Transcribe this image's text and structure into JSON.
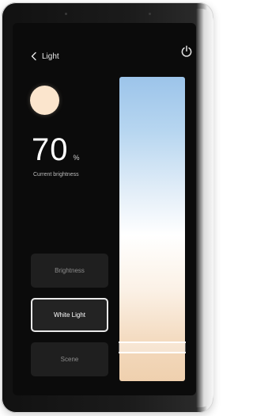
{
  "header": {
    "back_label": "Light"
  },
  "status": {
    "color_dot": "#fbe5cd",
    "brightness_value": "70",
    "brightness_unit": "%",
    "brightness_caption": "Current brightness"
  },
  "modes": [
    {
      "label": "Brightness",
      "active": false
    },
    {
      "label": "White Light",
      "active": true
    },
    {
      "label": "Scene",
      "active": false
    }
  ],
  "slider": {
    "gradient_top": "#9cc4ea",
    "gradient_middle": "#ffffff",
    "gradient_bottom": "#efd0ae",
    "handle_position_fraction": 0.89
  },
  "icons": {
    "back": "chevron-left-icon",
    "power": "power-icon"
  }
}
